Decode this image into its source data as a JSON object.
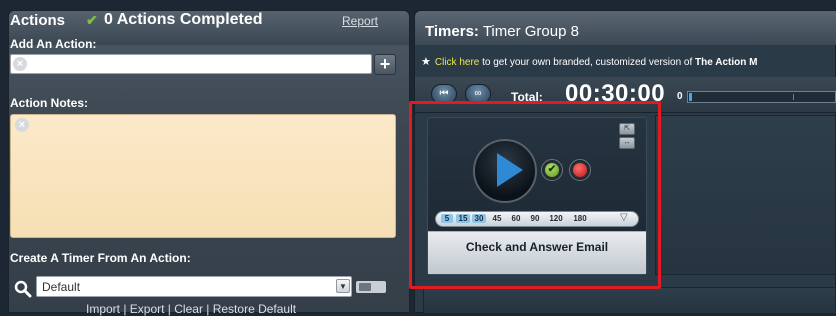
{
  "actions_panel": {
    "title": "Actions",
    "check_glyph": "✔",
    "completed_text": "0 Actions Completed",
    "report_link": "Report",
    "add_action_label": "Add An Action:",
    "add_input_value": "",
    "plus_label": "+",
    "notes_label": "Action Notes:",
    "notes_value": "",
    "create_label": "Create A Timer From An Action:",
    "select_value": "Default",
    "select_arrow": "▼",
    "import_row": "Import | Export | Clear | Restore Default"
  },
  "timers_panel": {
    "title_bold": "Timers:",
    "title_rest": "Timer Group 8",
    "promo_star": "★",
    "promo_link": "Click here",
    "promo_text": "to get your own branded, customized version of",
    "promo_strong": "The Action M",
    "total_label": "Total:",
    "total_time": "00:30:00",
    "progress_start": "0",
    "progress_fraction": 0.02,
    "rewind_glyph": "⏮",
    "loop_glyph": "∞"
  },
  "timer_card": {
    "minutes": [
      "5",
      "15",
      "30",
      "45",
      "60",
      "90",
      "120",
      "180"
    ],
    "selected_minutes": [
      "5",
      "15",
      "30"
    ],
    "minutes_arrow": "▽",
    "title": "Check and Answer Email",
    "complete_glyph": "✔",
    "ctrl_1_glyph": "⇱",
    "ctrl_2_glyph": "↔"
  },
  "colors": {
    "highlight": "#e11b22",
    "accent_blue": "#2f8ad6",
    "check_green": "#7cc242"
  },
  "icons": [
    "search-icon",
    "clear-icon",
    "plus-icon",
    "play-icon",
    "complete-icon",
    "stop-icon",
    "rewind-icon",
    "loop-icon",
    "star-icon",
    "toggle-icon"
  ]
}
